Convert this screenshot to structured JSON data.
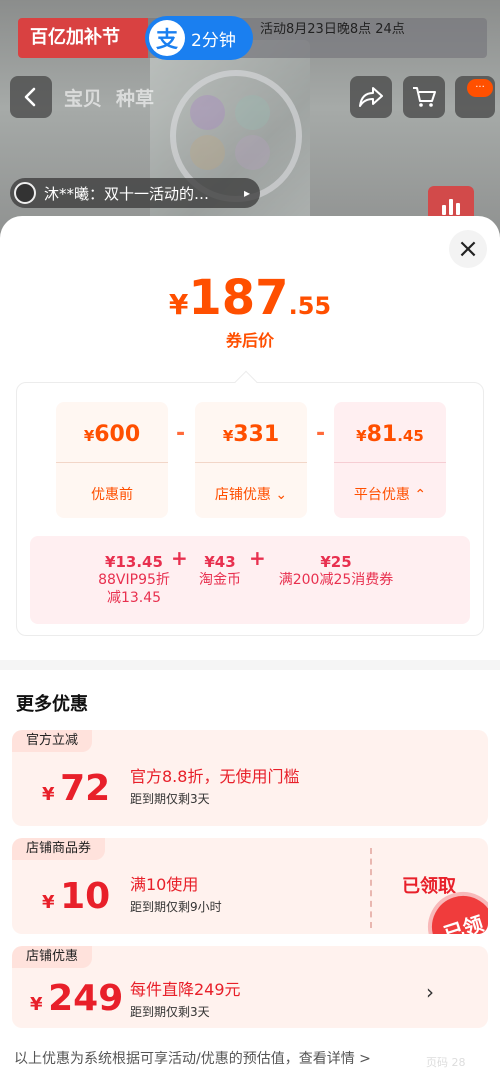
{
  "background": {
    "banner_title": "百亿加补节",
    "alipay_label": "2分钟",
    "banner_tip": "活动8月23日晚8点 24点",
    "tabs": [
      "宝贝",
      "种草"
    ],
    "notification": "···",
    "comment": "沐**曦：双十一活动的…"
  },
  "sheet": {
    "close_label": "×",
    "final_price": {
      "currency": "¥",
      "integer": "187",
      "decimal": ".55"
    },
    "final_price_label": "券后价",
    "breakdown": [
      {
        "currency": "¥",
        "integer": "600",
        "decimal": "",
        "label": "优惠前"
      },
      {
        "currency": "¥",
        "integer": "331",
        "decimal": "",
        "label": "店铺优惠 ⌄"
      },
      {
        "currency": "¥",
        "integer": "81",
        "decimal": ".45",
        "label": "平台优惠 ⌃"
      }
    ],
    "operator": "-",
    "platform_details": [
      {
        "value": "¥13.45",
        "label_line1": "88VIP95折",
        "label_line2": "减13.45"
      },
      {
        "value": "¥43",
        "label_line1": "淘金币",
        "label_line2": ""
      },
      {
        "value": "¥25",
        "label_line1": "满200减25消费券",
        "label_line2": ""
      }
    ],
    "plus": "+",
    "more_title": "更多优惠",
    "coupons": [
      {
        "tag": "官方立减",
        "currency": "¥",
        "amount": "72",
        "title": "官方8.8折，无使用门槛",
        "subtitle": "距到期仅剩3天"
      },
      {
        "tag": "店铺商品券",
        "currency": "¥",
        "amount": "10",
        "title": "满10使用",
        "subtitle": "距到期仅剩9小时",
        "status": "已领取",
        "stamp": "已领"
      },
      {
        "tag": "店铺优惠",
        "currency": "¥",
        "amount": "249",
        "title": "每件直降249元",
        "subtitle": "距到期仅剩3天",
        "action": "›"
      }
    ],
    "footer_note": "以上优惠为系统根据可享活动/优惠的预估值，查看详情 >",
    "footer_faint": "页码 28"
  },
  "colors": {
    "accent": "#ff4f00",
    "red": "#e8202a",
    "pink": "#e8304f",
    "banner": "#d94141",
    "alipay": "#1a7ff0"
  }
}
